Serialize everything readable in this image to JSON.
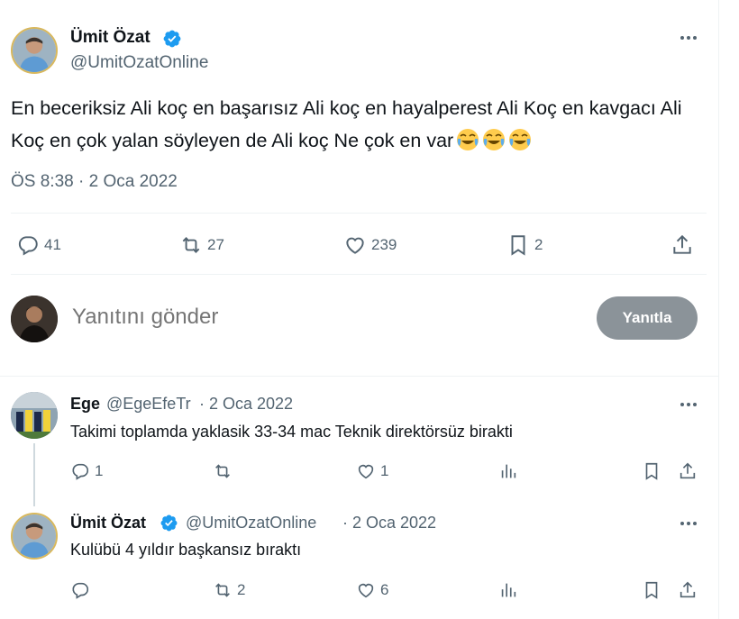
{
  "tweet": {
    "author_name": "Ümit Özat",
    "author_handle": "@UmitOzatOnline",
    "text": "En beceriksiz Ali koç en başarısız Ali koç en hayalperest Ali Koç en kavgacı Ali Koç en çok yalan söyleyen de Ali koç Ne çok en var",
    "emojis": [
      "face-with-tears-of-joy",
      "face-with-tears-of-joy",
      "face-with-tears-of-joy"
    ],
    "timestamp": "ÖS 8:38 · 2 Oca 2022",
    "stats": {
      "replies": "41",
      "retweets": "27",
      "likes": "239",
      "bookmarks": "2"
    }
  },
  "composer": {
    "placeholder": "Yanıtını gönder",
    "button_label": "Yanıtla"
  },
  "replies": [
    {
      "author_name": "Ege",
      "author_handle": "@EgeEfeTr",
      "date": "· 2 Oca 2022",
      "text": "Takimi toplamda yaklasik 33-34 mac Teknik direktörsüz birakti",
      "stats": {
        "replies": "1",
        "retweets": "",
        "likes": "1"
      }
    },
    {
      "author_name": "Ümit Özat",
      "author_handle": "@UmitOzatOnline",
      "date": "· 2 Oca 2022",
      "text": "Kulübü 4 yıldır başkansız bıraktı",
      "stats": {
        "replies": "",
        "retweets": "2",
        "likes": "6"
      }
    }
  ],
  "colors": {
    "verified": "#1d9bf0",
    "text_primary": "#0f1419",
    "text_secondary": "#536471",
    "divider": "#eff3f4",
    "button_disabled": "#8b9399"
  }
}
